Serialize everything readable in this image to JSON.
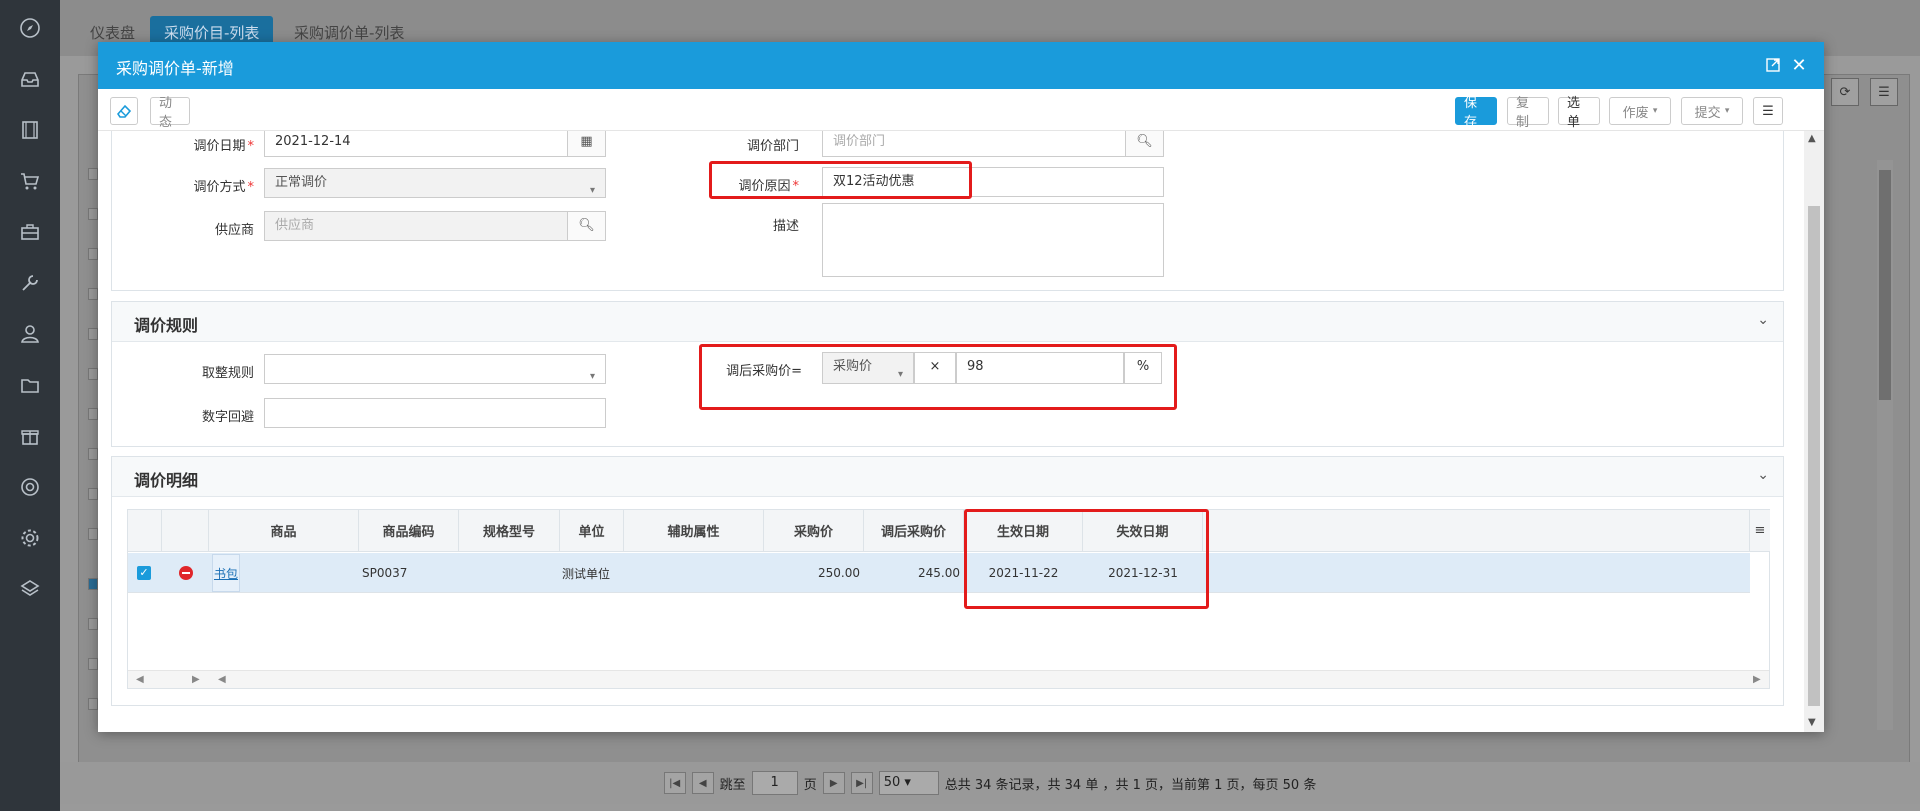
{
  "bg": {
    "tabs": [
      {
        "label": "仪表盘"
      },
      {
        "label": "采购价目-列表"
      },
      {
        "label": "采购调价单-列表"
      }
    ],
    "pager": {
      "jump_label": "跳至",
      "page_value": "1",
      "page_suffix": "页",
      "page_size": "50",
      "summary": "总共 34 条记录，共 34 单 ，共 1 页，当前第 1 页，每页 50 条"
    }
  },
  "modal": {
    "title": "采购调价单-新增",
    "toolbar": {
      "activity_label": "动态",
      "save_label": "保存",
      "copy_label": "复制",
      "select_label": "选单",
      "void_label": "作废",
      "submit_label": "提交"
    },
    "form": {
      "date_label": "调价日期",
      "date_value": "2021-12-14",
      "dept_label": "调价部门",
      "dept_placeholder": "调价部门",
      "method_label": "调价方式",
      "method_value": "正常调价",
      "reason_label": "调价原因",
      "reason_value": "双12活动优惠",
      "supplier_label": "供应商",
      "supplier_placeholder": "供应商",
      "desc_label": "描述",
      "required_mark": "*"
    },
    "rules": {
      "title": "调价规则",
      "rounding_label": "取整规则",
      "avoid_label": "数字回避",
      "price_label": "调后采购价=",
      "base_value": "采购价",
      "times_symbol": "×",
      "percent_value": "98",
      "percent_symbol": "%"
    },
    "detail": {
      "title": "调价明细",
      "columns": [
        "商品",
        "商品编码",
        "规格型号",
        "单位",
        "辅助属性",
        "采购价",
        "调后采购价",
        "生效日期",
        "失效日期"
      ],
      "rows": [
        {
          "product": "书包",
          "code": "SP0037",
          "spec": "",
          "unit": "测试单位",
          "aux": "",
          "price": "250.00",
          "new_price": "245.00",
          "start_date": "2021-11-22",
          "end_date": "2021-12-31"
        }
      ]
    }
  },
  "colors": {
    "header_blue": "#1a9bdb",
    "highlight_red": "#e31b1b",
    "row_selected": "#deebf7"
  }
}
